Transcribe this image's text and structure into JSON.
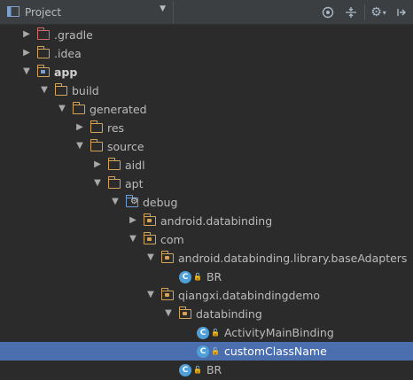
{
  "toolbar": {
    "view_label": "Project",
    "icons": [
      "target-icon",
      "collapse-icon",
      "gear-icon",
      "hide-icon"
    ]
  },
  "tree": [
    {
      "label": ".gradle",
      "icon": "folder-red",
      "expanded": false
    },
    {
      "label": ".idea",
      "icon": "folder",
      "expanded": false
    },
    {
      "label": "app",
      "icon": "module-folder",
      "expanded": true,
      "bold": true
    },
    {
      "label": "build",
      "icon": "folder",
      "expanded": true
    },
    {
      "label": "generated",
      "icon": "folder",
      "expanded": true
    },
    {
      "label": "res",
      "icon": "folder",
      "expanded": false
    },
    {
      "label": "source",
      "icon": "folder",
      "expanded": true
    },
    {
      "label": "aidl",
      "icon": "folder",
      "expanded": false
    },
    {
      "label": "apt",
      "icon": "folder",
      "expanded": true
    },
    {
      "label": "debug",
      "icon": "generated-source-folder",
      "expanded": true
    },
    {
      "label": "android.databinding",
      "icon": "package",
      "expanded": false
    },
    {
      "label": "com",
      "icon": "package",
      "expanded": true
    },
    {
      "label": "android.databinding.library.baseAdapters",
      "icon": "package",
      "expanded": true
    },
    {
      "label": "BR",
      "icon": "class",
      "expanded": null
    },
    {
      "label": "qiangxi.databindingdemo",
      "icon": "package",
      "expanded": true
    },
    {
      "label": "databinding",
      "icon": "package",
      "expanded": true
    },
    {
      "label": "ActivityMainBinding",
      "icon": "class",
      "expanded": null
    },
    {
      "label": "customClassName",
      "icon": "class",
      "expanded": null,
      "selected": true
    },
    {
      "label": "BR",
      "icon": "class",
      "expanded": null
    }
  ],
  "colors": {
    "background": "#2b2b2b",
    "selection": "#4b6eaf",
    "folder": "#d4a35a",
    "class_icon": "#4f9fd8"
  }
}
